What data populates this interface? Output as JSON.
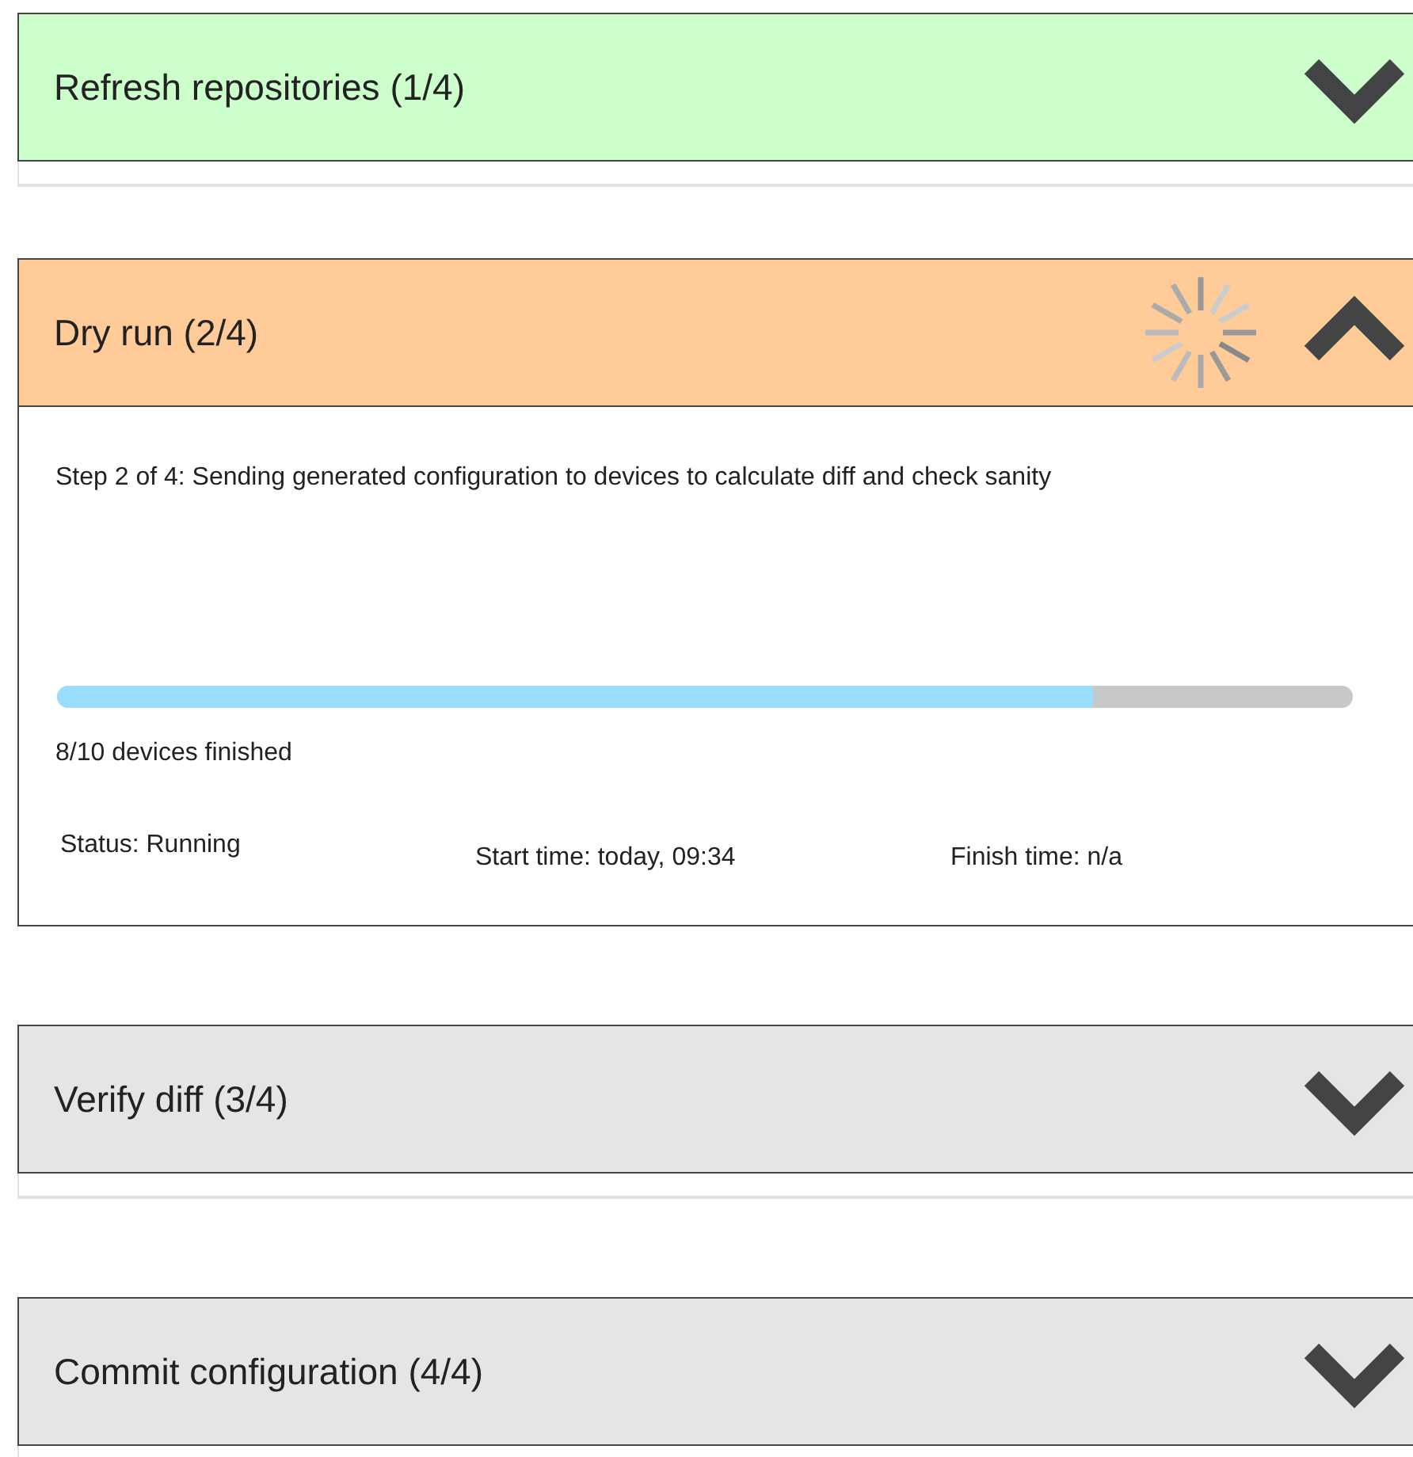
{
  "steps": [
    {
      "title": "Refresh repositories (1/4)",
      "color": "#ccffcc",
      "expanded": false,
      "busy": false
    },
    {
      "title": "Dry run (2/4)",
      "color": "#ffcc99",
      "expanded": true,
      "busy": true,
      "description": "Step 2 of 4: Sending generated configuration to devices to calculate diff and check sanity",
      "progress": {
        "level": 0.8,
        "caption": "8/10 devices finished"
      },
      "status_text": "Status: Running",
      "start_time": "Start time: today, 09:34",
      "finish_time": "Finish time: n/a"
    },
    {
      "title": "Verify diff (3/4)",
      "color": "#e5e5e5",
      "expanded": false,
      "busy": false
    },
    {
      "title": "Commit configuration (4/4)",
      "color": "#e5e5e5",
      "expanded": false,
      "busy": false
    }
  ]
}
